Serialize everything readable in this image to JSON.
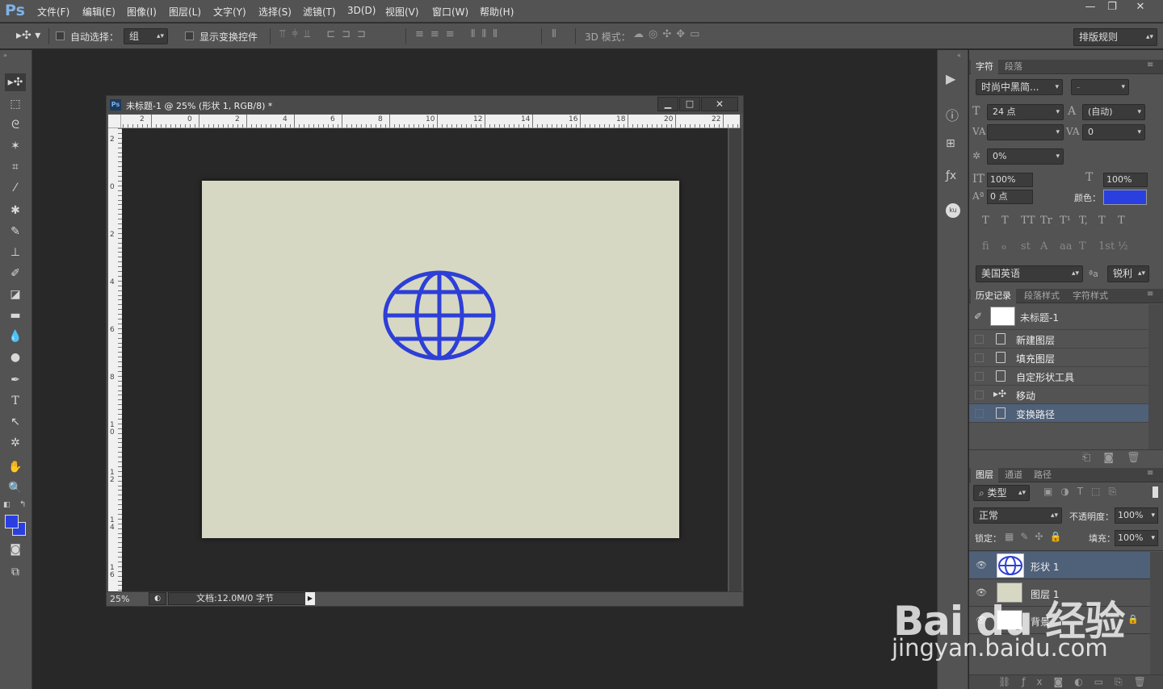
{
  "app": {
    "logo": "Ps"
  },
  "menus": [
    "文件(F)",
    "编辑(E)",
    "图像(I)",
    "图层(L)",
    "文字(Y)",
    "选择(S)",
    "滤镜(T)",
    "3D(D)",
    "视图(V)",
    "窗口(W)",
    "帮助(H)"
  ],
  "window_controls": {
    "minimize": "—",
    "restore": "❐",
    "close": "✕"
  },
  "options": {
    "auto_select_label": "自动选择：",
    "auto_select_value": "组",
    "show_transform_label": "显示变换控件",
    "mode3d_label": "3D 模式：",
    "layout_rule": "排版规则"
  },
  "document": {
    "title": "未标题-1 @ 25% (形状 1, RGB/8) *",
    "tab_icon": "Ps",
    "ruler_top": [
      "2",
      "0",
      "2",
      "4",
      "6",
      "8",
      "10",
      "12",
      "14",
      "16",
      "18",
      "20",
      "22"
    ],
    "ruler_left": [
      "2",
      "0",
      "2",
      "4",
      "6",
      "8",
      "1 0",
      "1 2",
      "1 4",
      "1 6"
    ],
    "zoom": "25%",
    "doc_info": "文档:12.0M/0 字节",
    "canvas_color": "#d7d8c4",
    "globe_color": "#2d3fd6"
  },
  "character_panel": {
    "tabs": [
      "字符",
      "段落"
    ],
    "font_family": "时尚中黑简...",
    "font_style": "-",
    "size": "24 点",
    "leading": "(自动)",
    "kerning": "",
    "tracking": "0",
    "tsume": "0%",
    "vscale": "100%",
    "hscale": "100%",
    "baseline": "0 点",
    "color_label": "颜色：",
    "color": "#2a3fe0",
    "style_buttons": [
      "T",
      "T",
      "TT",
      "Tr",
      "T¹",
      "T,",
      "T",
      "T"
    ],
    "ot_buttons": [
      "fi",
      "ℴ",
      "st",
      "A",
      "aa",
      "T",
      "1st",
      "½"
    ],
    "language": "美国英语",
    "aa_label": "ªa",
    "antialias": "锐利"
  },
  "history_panel": {
    "tabs": [
      "历史记录",
      "段落样式",
      "字符样式"
    ],
    "snapshot": "未标题-1",
    "items": [
      "新建图层",
      "填充图层",
      "自定形状工具",
      "移动",
      "变换路径"
    ]
  },
  "layers_panel": {
    "tabs": [
      "图层",
      "通道",
      "路径"
    ],
    "filter_kind": "类型",
    "blend_mode": "正常",
    "opacity_label": "不透明度：",
    "opacity": "100%",
    "lock_label": "锁定：",
    "fill_label": "填充：",
    "fill": "100%",
    "layers": [
      "形状 1",
      "图层 1",
      "背景"
    ]
  },
  "watermark": {
    "brand": "Bai du 经验",
    "url": "jingyan.baidu.com"
  }
}
